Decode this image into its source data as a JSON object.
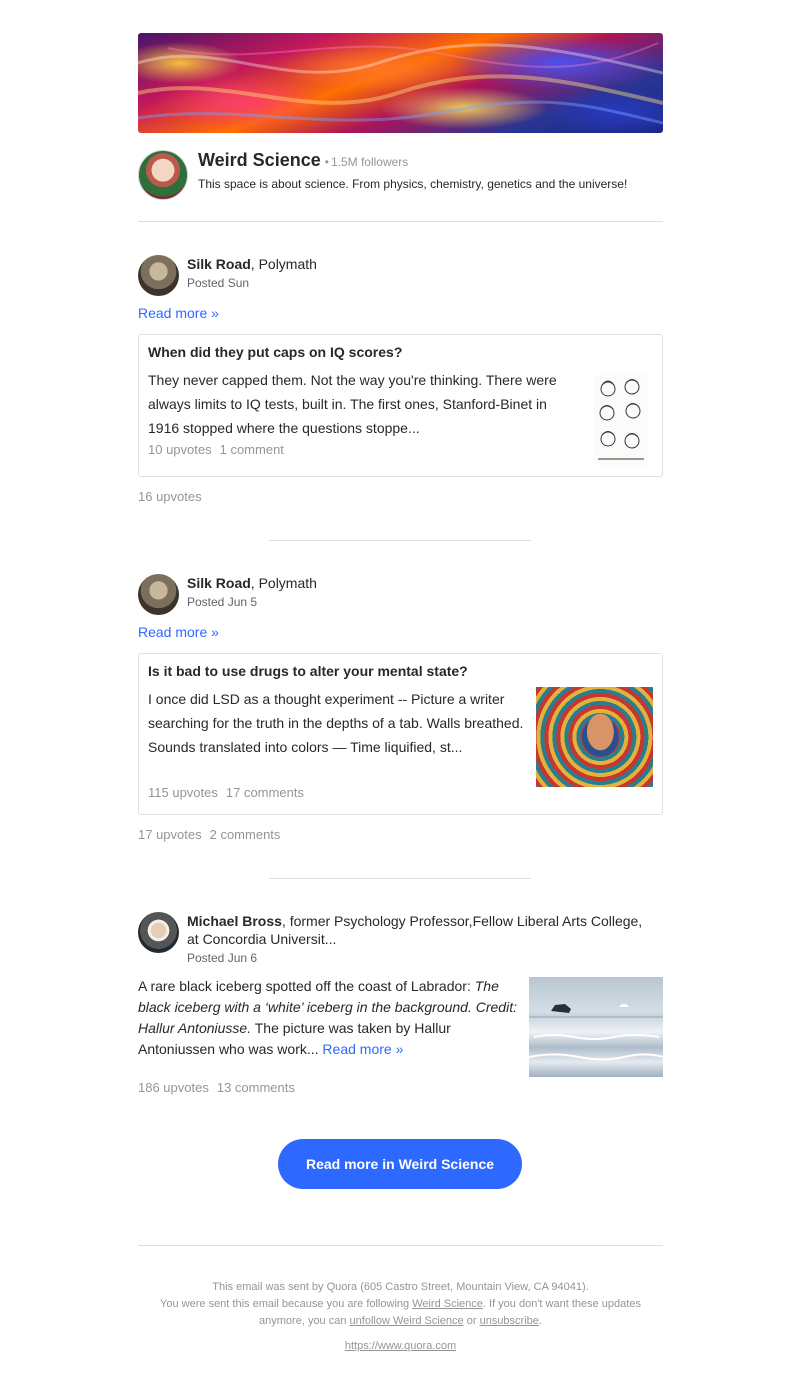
{
  "space": {
    "name": "Weird Science",
    "followers": "1.5M followers",
    "description": "This space is about science. From physics, chemistry, genetics and the universe!"
  },
  "posts": [
    {
      "author": "Silk Road",
      "credential": ", Polymath",
      "posted": "Posted Sun",
      "read_more": "Read more »",
      "card": {
        "question": "When did they put caps on IQ scores?",
        "excerpt": "They never capped them. Not the way you're thinking. There were always limits to IQ tests, built in. The first ones, Stanford-Binet in 1916 stopped where the questions stoppe...",
        "upvotes": "10 upvotes",
        "comments": "1 comment"
      },
      "upvotes": "16 upvotes"
    },
    {
      "author": "Silk Road",
      "credential": ", Polymath",
      "posted": "Posted Jun 5",
      "read_more": "Read more »",
      "card": {
        "question": "Is it bad to use drugs to alter your mental state?",
        "excerpt": "I once did LSD as a thought experiment -- Picture a writer searching for the truth in the depths of a tab. Walls breathed. Sounds translated into colors — Time liquified, st...",
        "upvotes": "115 upvotes",
        "comments": "17 comments"
      },
      "upvotes": "17 upvotes",
      "comments": "2 comments"
    },
    {
      "author": "Michael Bross",
      "credential": ", former Psychology Professor,Fellow Liberal Arts College, at Concordia Universit...",
      "posted": "Posted Jun 6",
      "text_lead": "A rare black iceberg spotted off the coast of Labrador: ",
      "text_italic": "The black iceberg with a ‘white’ iceberg in the background. Credit: Hallur Antoniusse.",
      "text_rest": " The picture was taken by Hallur Antoniussen who was work... ",
      "read_more": "Read more »",
      "upvotes": "186 upvotes",
      "comments": "13 comments"
    }
  ],
  "cta_label": "Read more in Weird Science",
  "footer": {
    "line1": "This email was sent by Quora (605 Castro Street, Mountain View, CA 94041).",
    "line2_a": "You were sent this email because you are following ",
    "link_space": "Weird Science",
    "line2_b": ". If you don't want these updates anymore, you can ",
    "link_unfollow": "unfollow Weird Science",
    "line2_c": " or ",
    "link_unsubscribe": "unsubscribe",
    "line2_d": ".",
    "url": "https://www.quora.com"
  },
  "colors": {
    "link": "#2e69ff",
    "muted": "#939598",
    "text": "#282829"
  }
}
